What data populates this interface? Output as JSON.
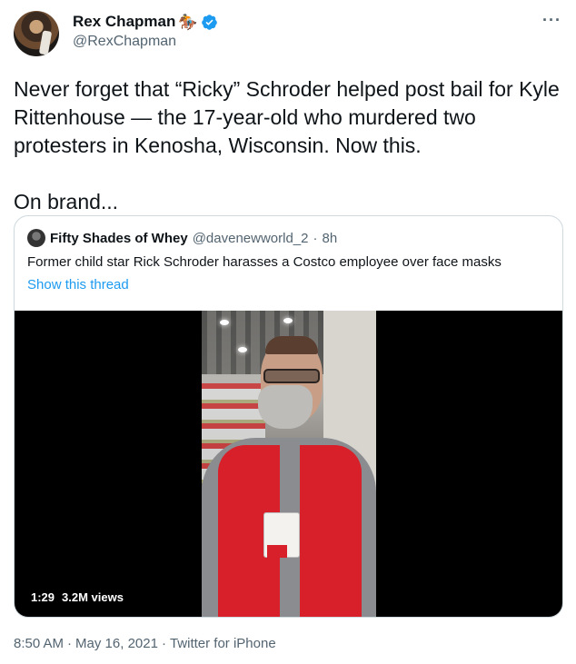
{
  "author": {
    "display_name": "Rex Chapman",
    "emoji": "🏇",
    "handle": "@RexChapman",
    "more": "···"
  },
  "tweet": {
    "text": "Never forget that “Ricky” Schroder helped post bail for Kyle Rittenhouse — the 17-year-old who murdered two protesters in Kenosha, Wisconsin. Now this.\n\nOn brand..."
  },
  "quoted_tweet": {
    "display_name": "Fifty Shades of Whey",
    "handle": "@davenewworld_2",
    "separator": "·",
    "time": "8h",
    "text": "Former child star Rick Schroder harasses a Costco employee over face masks",
    "show_thread": "Show this thread",
    "video": {
      "duration": "1:29",
      "views": "3.2M views"
    }
  },
  "footer": {
    "time": "8:50 AM",
    "sep1": "·",
    "date": "May 16, 2021",
    "sep2": "·",
    "source": "Twitter for iPhone"
  },
  "colors": {
    "link": "#1d9bf0",
    "verified": "#1d9bf0",
    "secondary_text": "#536471",
    "border": "#cfd9de"
  }
}
